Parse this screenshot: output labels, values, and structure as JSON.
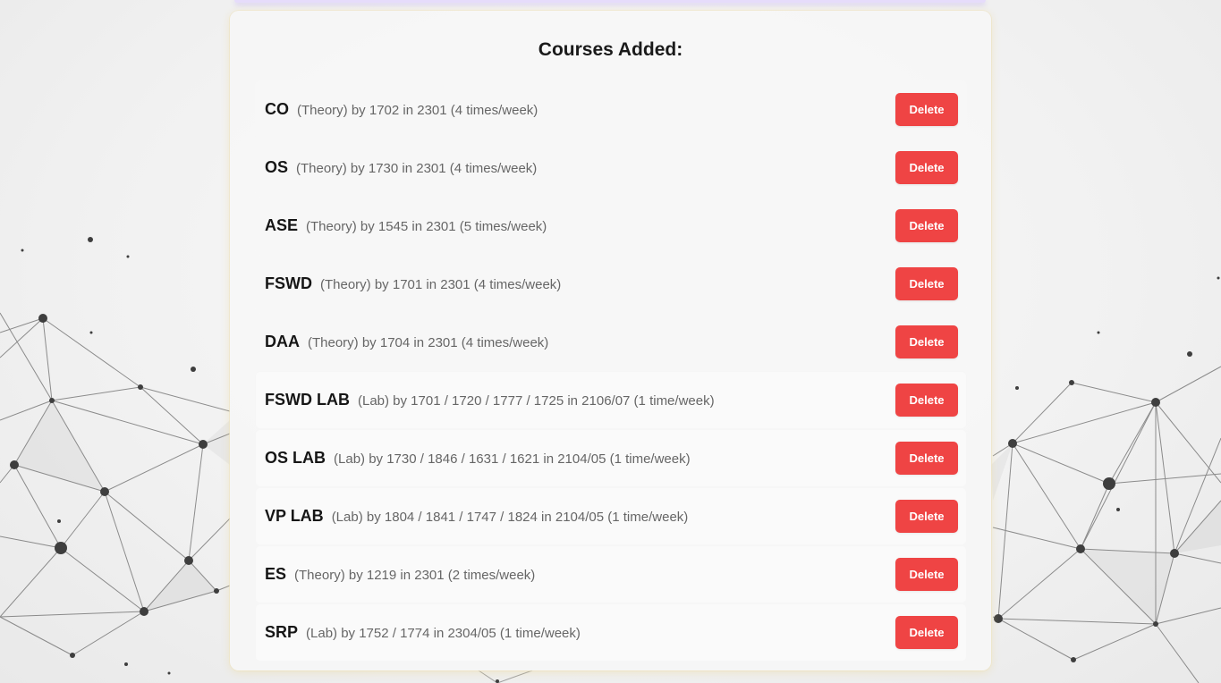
{
  "panel": {
    "title": "Courses Added:"
  },
  "colors": {
    "delete_button": "#ef4444",
    "panel_background": "#f6f6f6",
    "top_strip_accent": "#e6dcfb"
  },
  "icons": {
    "background": "network-mesh-graphic"
  },
  "courses": [
    {
      "code": "CO",
      "details": "(Theory) by 1702 in 2301 (4 times/week)",
      "action": "Delete"
    },
    {
      "code": "OS",
      "details": "(Theory) by 1730 in 2301 (4 times/week)",
      "action": "Delete"
    },
    {
      "code": "ASE",
      "details": "(Theory) by 1545 in 2301 (5 times/week)",
      "action": "Delete"
    },
    {
      "code": "FSWD",
      "details": "(Theory) by 1701 in 2301 (4 times/week)",
      "action": "Delete"
    },
    {
      "code": "DAA",
      "details": "(Theory) by 1704 in 2301 (4 times/week)",
      "action": "Delete"
    },
    {
      "code": "FSWD LAB",
      "details": "(Lab) by 1701 / 1720 / 1777 / 1725 in 2106/07 (1 time/week)",
      "action": "Delete"
    },
    {
      "code": "OS LAB",
      "details": "(Lab) by 1730 / 1846 / 1631 / 1621 in 2104/05 (1 time/week)",
      "action": "Delete"
    },
    {
      "code": "VP LAB",
      "details": "(Lab) by 1804 / 1841 / 1747 / 1824 in 2104/05 (1 time/week)",
      "action": "Delete"
    },
    {
      "code": "ES",
      "details": "(Theory) by 1219 in 2301 (2 times/week)",
      "action": "Delete"
    },
    {
      "code": "SRP",
      "details": "(Lab) by 1752 / 1774 in 2304/05 (1 time/week)",
      "action": "Delete"
    }
  ]
}
